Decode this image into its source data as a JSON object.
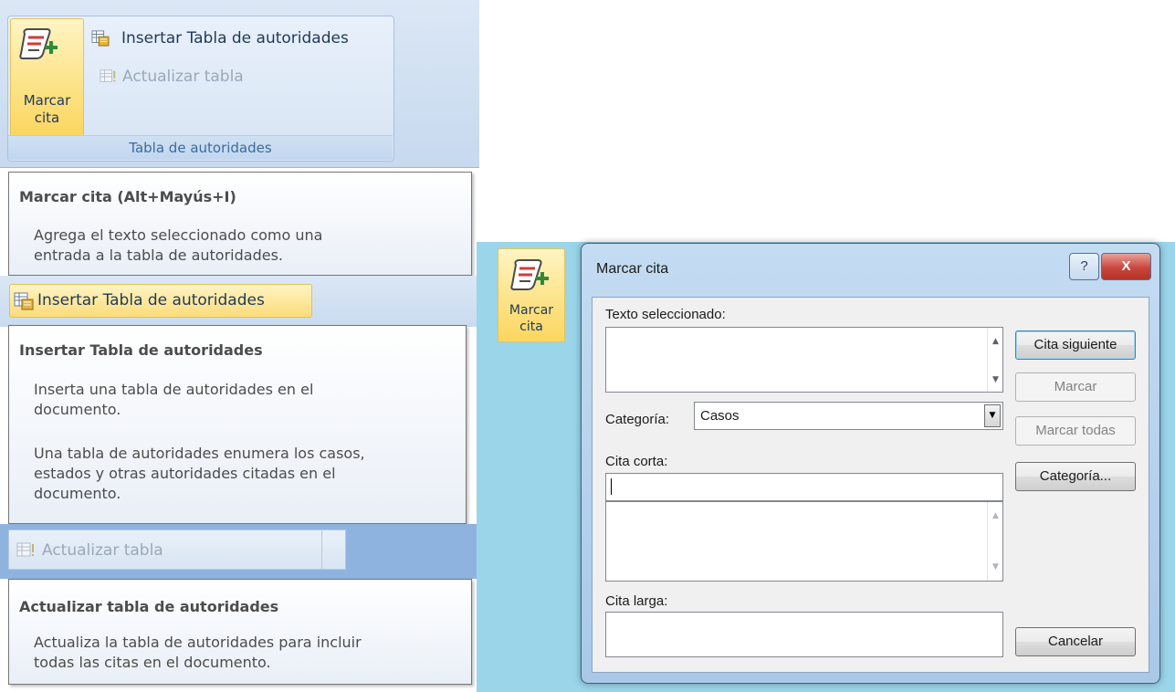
{
  "ribbon": {
    "big_button_label": "Marcar cita",
    "items": [
      {
        "label": "Insertar Tabla de autoridades",
        "enabled": true
      },
      {
        "label": "Actualizar tabla",
        "enabled": false
      }
    ],
    "group_label": "Tabla de autoridades"
  },
  "tooltips": [
    {
      "title": "Marcar cita (Alt+Mayús+I)",
      "body": [
        "Agrega el texto seleccionado como una",
        "entrada a la tabla de autoridades."
      ]
    },
    {
      "hovered_item": "Insertar Tabla de autoridades",
      "title": "Insertar Tabla de autoridades",
      "body": [
        "Inserta una tabla de autoridades en el",
        "documento."
      ],
      "body2": [
        "Una tabla de autoridades enumera los casos,",
        "estados y otras autoridades citadas en el",
        "documento."
      ]
    },
    {
      "hovered_item": "Actualizar tabla",
      "title": "Actualizar tabla de autoridades",
      "body": [
        "Actualiza la tabla de autoridades para incluir",
        "todas las citas en el documento."
      ]
    }
  ],
  "dialog_launcher": {
    "label": "Marcar cita"
  },
  "dialog": {
    "title": "Marcar cita",
    "help_label": "?",
    "close_label": "X",
    "selected_text_label": "Texto seleccionado:",
    "selected_text_value": "",
    "category_label": "Categoría:",
    "category_value": "Casos",
    "short_citation_label": "Cita corta:",
    "short_citation_value": "",
    "long_citation_label": "Cita larga:",
    "long_citation_value": "",
    "buttons": {
      "next_citation": "Cita siguiente",
      "mark": "Marcar",
      "mark_all": "Marcar todas",
      "category": "Categoría...",
      "cancel": "Cancelar"
    },
    "buttons_enabled": {
      "next_citation": true,
      "mark": false,
      "mark_all": false,
      "category": true,
      "cancel": true
    }
  },
  "colors": {
    "ribbon_text": "#1e395b",
    "highlight": "#fde694",
    "tooltip_text": "#4c4c4c",
    "dialog_bg": "#f0f0f0",
    "close_button": "#c9463d",
    "backdrop": "#9ad5ea"
  },
  "icons": {
    "mark_citation": "scroll-plus-icon",
    "insert_table": "table-insert-icon",
    "update_table": "table-update-icon"
  }
}
